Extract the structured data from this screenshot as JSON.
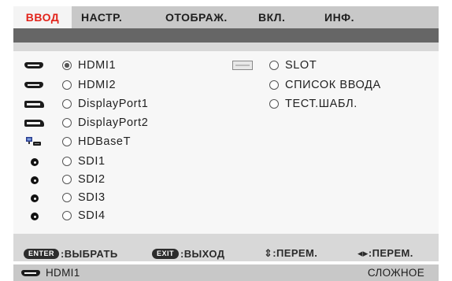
{
  "tabs": [
    {
      "label": "ВВОД"
    },
    {
      "label": "НАСТР."
    },
    {
      "label": "ОТОБРАЖ."
    },
    {
      "label": "ВКЛ."
    },
    {
      "label": "ИНФ."
    }
  ],
  "inputs_left": [
    {
      "label": "HDMI1",
      "icon": "hdmi-icon",
      "selected": true
    },
    {
      "label": "HDMI2",
      "icon": "hdmi-icon",
      "selected": false
    },
    {
      "label": "DisplayPort1",
      "icon": "displayport-icon",
      "selected": false
    },
    {
      "label": "DisplayPort2",
      "icon": "displayport-icon",
      "selected": false
    },
    {
      "label": "HDBaseT",
      "icon": "hdbaset-icon",
      "selected": false
    },
    {
      "label": "SDI1",
      "icon": "sdi-icon",
      "selected": false
    },
    {
      "label": "SDI2",
      "icon": "sdi-icon",
      "selected": false
    },
    {
      "label": "SDI3",
      "icon": "sdi-icon",
      "selected": false
    },
    {
      "label": "SDI4",
      "icon": "sdi-icon",
      "selected": false
    }
  ],
  "inputs_right": [
    {
      "label": "SLOT",
      "icon": "slot-icon",
      "selected": false
    },
    {
      "label": "СПИСОК ВВОДА",
      "icon": "",
      "selected": false
    },
    {
      "label": "ТЕСТ.ШАБЛ.",
      "icon": "",
      "selected": false
    }
  ],
  "help": {
    "enter_key": "ENTER",
    "enter_action": ":ВЫБРАТЬ",
    "exit_key": "EXIT",
    "exit_action": ":ВЫХОД",
    "updown_action": "⇕:ПЕРЕМ.",
    "leftright_action": "◂▸:ПЕРЕМ."
  },
  "status": {
    "source": "HDMI1",
    "mode": "СЛОЖНОЕ"
  },
  "colors": {
    "active_tab_text": "#e2231a",
    "tab_bar": "#c8c8c8",
    "panel": "#d8d8d8",
    "content": "#f7f7f7"
  }
}
